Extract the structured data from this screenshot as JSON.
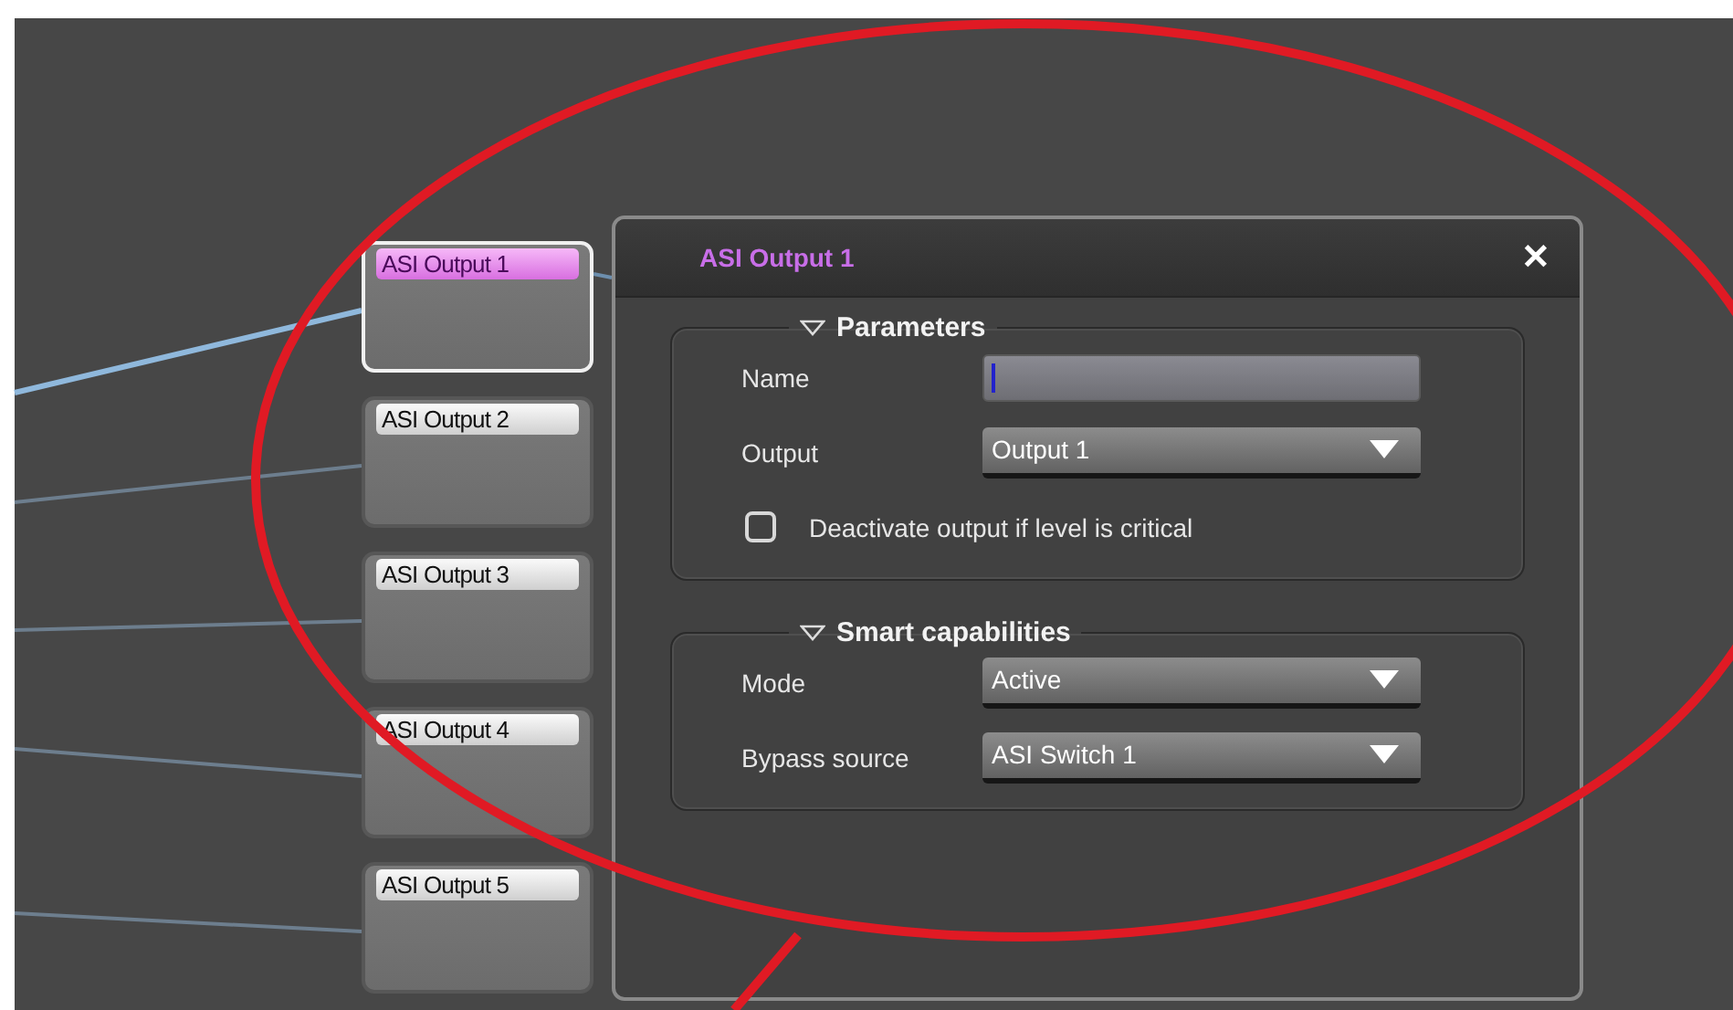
{
  "nodes": [
    {
      "label": "ASI Output 1",
      "selected": true
    },
    {
      "label": "ASI Output 2",
      "selected": false
    },
    {
      "label": "ASI Output 3",
      "selected": false
    },
    {
      "label": "ASI Output 4",
      "selected": false
    },
    {
      "label": "ASI Output 5",
      "selected": false
    }
  ],
  "dialog": {
    "title": "ASI Output 1",
    "close": "✕",
    "sections": [
      {
        "title": "Parameters",
        "expanded": true,
        "rows": [
          {
            "kind": "text",
            "label": "Name",
            "focused": true
          },
          {
            "kind": "select",
            "label": "Output",
            "value": "Output 1"
          },
          {
            "kind": "checkbox",
            "label": "Deactivate output if level is critical",
            "checked": false
          }
        ]
      },
      {
        "title": "Smart capabilities",
        "expanded": true,
        "rows": [
          {
            "kind": "select",
            "label": "Mode",
            "value": "Active"
          },
          {
            "kind": "select",
            "label": "Bypass source",
            "value": "ASI Switch 1"
          }
        ]
      }
    ]
  }
}
